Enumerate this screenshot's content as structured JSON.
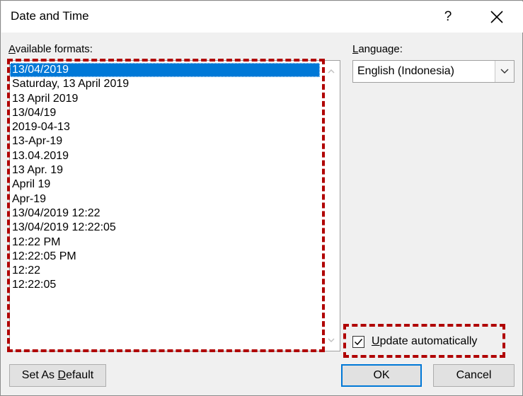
{
  "window": {
    "title": "Date and Time",
    "help_label": "?"
  },
  "formats": {
    "label_prefix": "A",
    "label_rest": "vailable formats:",
    "items": [
      "13/04/2019",
      "Saturday, 13 April 2019",
      "13 April 2019",
      "13/04/19",
      "2019-04-13",
      "13-Apr-19",
      "13.04.2019",
      "13 Apr. 19",
      "April 19",
      "Apr-19",
      "13/04/2019 12:22",
      "13/04/2019 12:22:05",
      "12:22 PM",
      "12:22:05 PM",
      "12:22",
      "12:22:05"
    ],
    "selected_index": 0
  },
  "language": {
    "label_prefix": "L",
    "label_rest": "anguage:",
    "value": "English (Indonesia)"
  },
  "update_automatically": {
    "label_prefix": "U",
    "label_rest": "pdate automatically",
    "checked": true
  },
  "buttons": {
    "set_default_prefix": "Set As ",
    "set_default_accel": "D",
    "set_default_rest": "efault",
    "ok": "OK",
    "cancel": "Cancel"
  },
  "colors": {
    "selection": "#0078d7",
    "highlight_dash": "#b00000",
    "dialog_bg": "#f0f0f0"
  },
  "icons": [
    "close-icon",
    "chevron-down-icon",
    "scroll-up-icon",
    "scroll-down-icon",
    "checkmark-icon"
  ]
}
